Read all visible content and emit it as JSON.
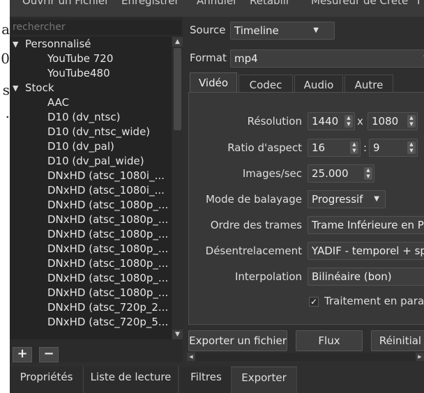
{
  "menubar": [
    "Ouvrir un Fichier",
    "Enregistrer",
    "Annuler",
    "Rétablir",
    "Mesureur de Crête",
    "I"
  ],
  "background_doc": [
    "a",
    "0",
    "s",
    "."
  ],
  "left_panel": {
    "search_placeholder": "rechercher",
    "tree": [
      {
        "label": "Personnalisé",
        "level": 0,
        "expander": "▼"
      },
      {
        "label": "YouTube 720",
        "level": 2
      },
      {
        "label": "YouTube480",
        "level": 2
      },
      {
        "label": "Stock",
        "level": 0,
        "expander": "▼"
      },
      {
        "label": "AAC",
        "level": 2
      },
      {
        "label": "D10 (dv_ntsc)",
        "level": 2
      },
      {
        "label": "D10 (dv_ntsc_wide)",
        "level": 2
      },
      {
        "label": "D10 (dv_pal)",
        "level": 2
      },
      {
        "label": "D10 (dv_pal_wide)",
        "level": 2
      },
      {
        "label": "DNxHD (atsc_1080i_...",
        "level": 2
      },
      {
        "label": "DNxHD (atsc_1080i_...",
        "level": 2
      },
      {
        "label": "DNxHD (atsc_1080p_...",
        "level": 2
      },
      {
        "label": "DNxHD (atsc_1080p_...",
        "level": 2
      },
      {
        "label": "DNxHD (atsc_1080p_...",
        "level": 2
      },
      {
        "label": "DNxHD (atsc_1080p_...",
        "level": 2
      },
      {
        "label": "DNxHD (atsc_1080p_...",
        "level": 2
      },
      {
        "label": "DNxHD (atsc_1080p_...",
        "level": 2
      },
      {
        "label": "DNxHD (atsc_1080p_...",
        "level": 2
      },
      {
        "label": "DNxHD (atsc_720p_2...",
        "level": 2
      },
      {
        "label": "DNxHD (atsc_720p_5...",
        "level": 2
      }
    ],
    "add_symbol": "+",
    "remove_symbol": "−"
  },
  "export": {
    "source_label": "Source",
    "source_value": "Timeline",
    "format_label": "Format",
    "format_value": "mp4",
    "tabs": [
      "Vidéo",
      "Codec",
      "Audio",
      "Autre"
    ],
    "active_tab": "Vidéo",
    "video": {
      "resolution_label": "Résolution",
      "width": "1440",
      "by": "x",
      "height": "1080",
      "aspect_label": "Ratio d'aspect",
      "aspect_num": "16",
      "aspect_sep": ":",
      "aspect_den": "9",
      "fps_label": "Images/sec",
      "fps": "25.000",
      "scan_label": "Mode de balayage",
      "scan_value": "Progressif",
      "field_label": "Ordre des trames",
      "field_value": "Trame Inférieure en Pre",
      "deinterlace_label": "Désentrelacement",
      "deinterlace_value": "YADIF - temporel + spa",
      "interp_label": "Interpolation",
      "interp_value": "Bilinéaire (bon)",
      "parallel_label": "Traitement en parallè",
      "parallel_checked": true,
      "check_mark": "✓"
    },
    "buttons": {
      "export_file": "Exporter un fichier",
      "stream": "Flux",
      "reset": "Réinitial"
    }
  },
  "dock_tabs": [
    {
      "label": "Propriétés",
      "active": false
    },
    {
      "label": "Liste de lecture",
      "active": false
    },
    {
      "label": "Filtres",
      "active": false
    },
    {
      "label": "Exporter",
      "active": true
    }
  ],
  "colors": {
    "panel_bg": "#2f2f2f",
    "tree_bg": "#242424",
    "widget_bg": "#3e3e3e",
    "text": "#e4e4e4"
  }
}
